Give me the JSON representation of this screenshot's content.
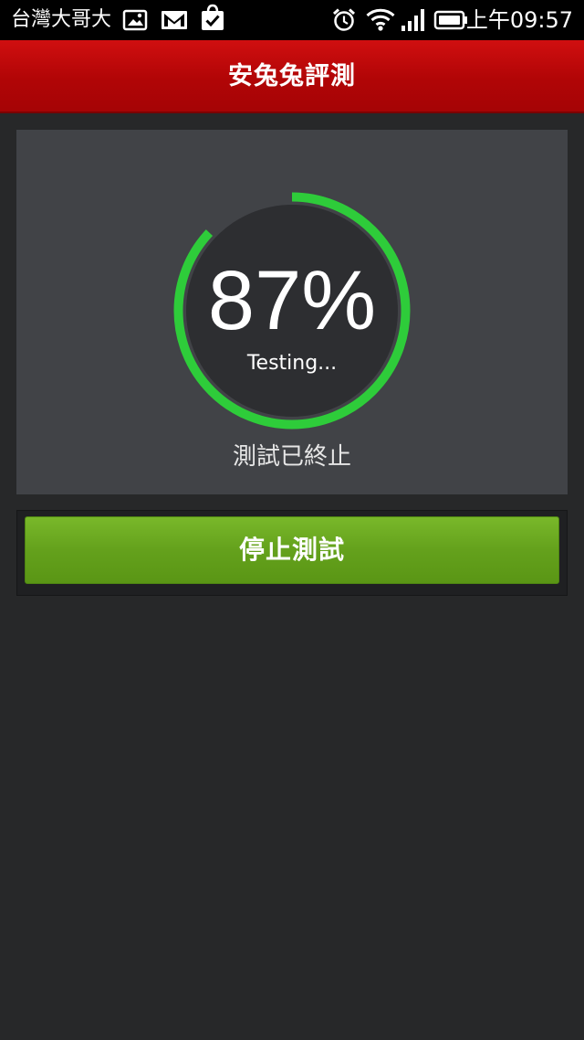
{
  "status_bar": {
    "carrier": "台灣大哥大",
    "clock": "上午09:57",
    "icons": [
      "gallery-icon",
      "gmail-icon",
      "store-bag-icon",
      "alarm-icon",
      "wifi-icon",
      "signal-icon",
      "battery-icon"
    ]
  },
  "header": {
    "title": "安兔兔評測"
  },
  "test": {
    "progress_percent": 87,
    "percent_label": "87%",
    "state_label": "Testing...",
    "status_caption": "測試已終止"
  },
  "actions": {
    "stop_label": "停止測試"
  },
  "colors": {
    "title_bar": "#c00a0b",
    "background": "#272829",
    "panel": "#414347",
    "ring_track": "#2d2e31",
    "ring_progress": "#2ecc3a",
    "button": "#69a620"
  }
}
